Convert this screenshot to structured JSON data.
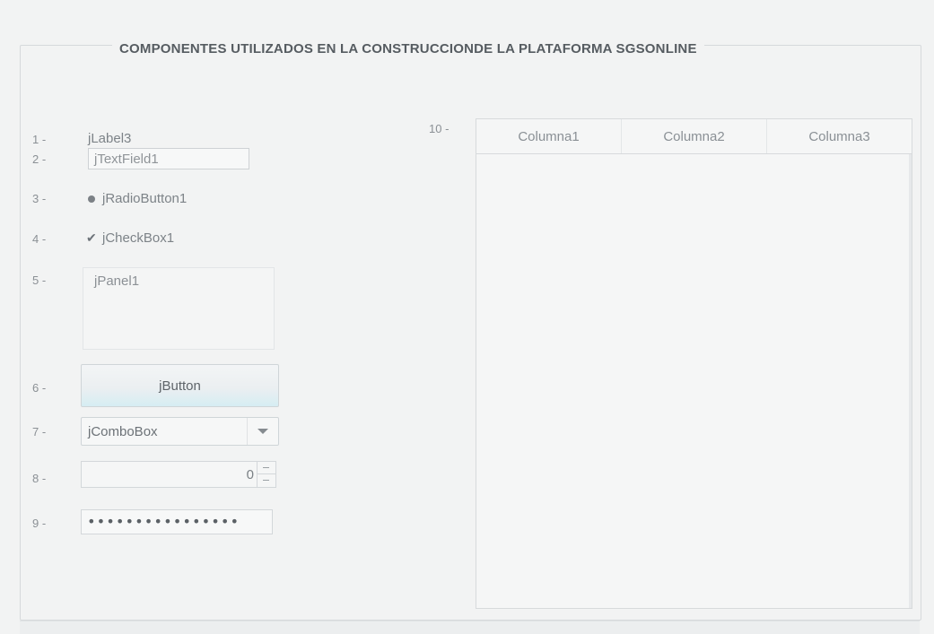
{
  "title": "COMPONENTES UTILIZADOS EN LA CONSTRUCCIONDE LA PLATAFORMA SGSONLINE",
  "numbers": [
    "1 -",
    "2 -",
    "3 -",
    "4 -",
    "5 -",
    "6 -",
    "7 -",
    "8 -",
    "9 -",
    "10 -"
  ],
  "label": {
    "text": "jLabel3"
  },
  "text_field": {
    "value": "jTextField1"
  },
  "radio": {
    "label": "jRadioButton1",
    "selected": true
  },
  "checkbox": {
    "label": "jCheckBox1",
    "checked": true,
    "check_glyph": "✔"
  },
  "panel": {
    "label": "jPanel1"
  },
  "button": {
    "label": "jButton"
  },
  "combo": {
    "value": "jComboBox"
  },
  "spinner": {
    "value": "0"
  },
  "password": {
    "value": "••••••••••••••••"
  },
  "table": {
    "columns": [
      "Columna1",
      "Columna2",
      "Columna3"
    ]
  },
  "colors": {
    "background": "#f2f3f3",
    "border": "#d6d9db",
    "button_highlight": "#d6edf3"
  },
  "icons": {
    "combo_arrow": "chevron-down-icon",
    "radio": "radio-dot-icon",
    "check": "check-icon",
    "spinner": "spinner-arrows-icon"
  }
}
